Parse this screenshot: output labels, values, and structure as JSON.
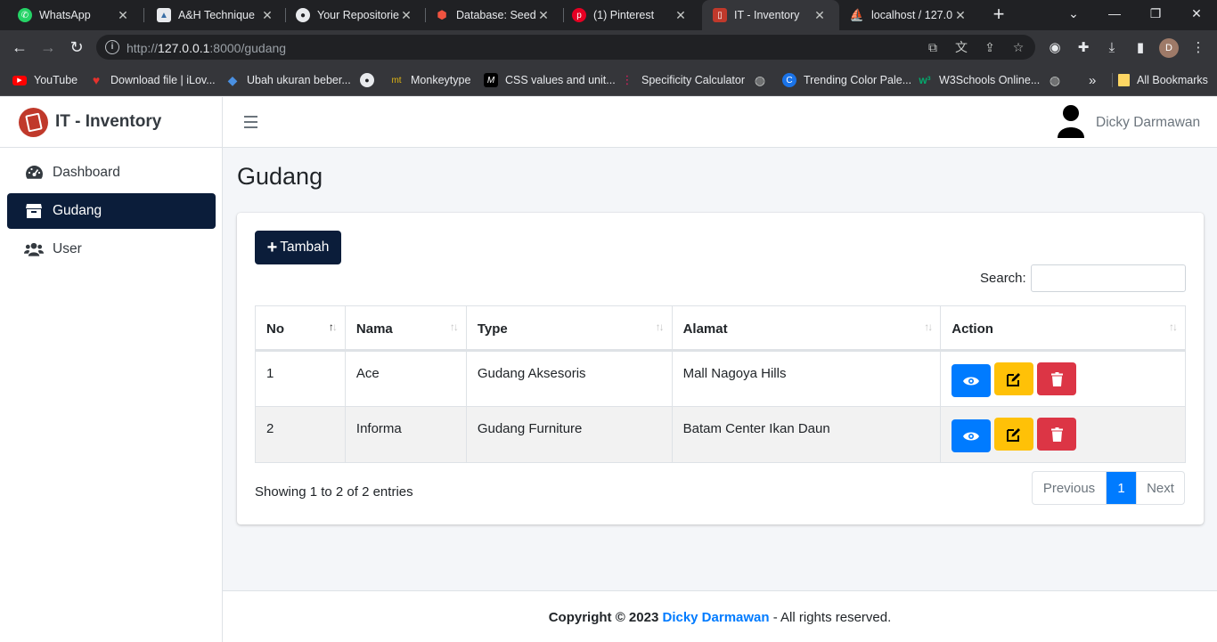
{
  "browser": {
    "tabs": [
      {
        "title": "WhatsApp",
        "icon": "whatsapp-icon"
      },
      {
        "title": "A&H Technique",
        "icon": "ah-icon"
      },
      {
        "title": "Your Repositorie",
        "icon": "github-icon"
      },
      {
        "title": "Database: Seedi",
        "icon": "laravel-icon"
      },
      {
        "title": "(1) Pinterest",
        "icon": "pinterest-icon"
      },
      {
        "title": "IT - Inventory",
        "icon": "book-icon"
      },
      {
        "title": "localhost / 127.0",
        "icon": "phpmyadmin-icon"
      }
    ],
    "url_prefix": "http://",
    "url_host": "127.0.0.1",
    "url_rest": ":8000/gudang",
    "bookmarks": [
      {
        "label": "YouTube"
      },
      {
        "label": "Download file | iLov..."
      },
      {
        "label": "Ubah ukuran beber..."
      },
      {
        "label": ""
      },
      {
        "label": "Monkeytype"
      },
      {
        "label": "CSS values and unit..."
      },
      {
        "label": "Specificity Calculator"
      },
      {
        "label": ""
      },
      {
        "label": "Trending Color Pale..."
      },
      {
        "label": "W3Schools Online..."
      },
      {
        "label": ""
      }
    ],
    "more_bookmarks": "»",
    "all_bookmarks": "All Bookmarks",
    "profile_initial": "D"
  },
  "app": {
    "brand": "IT - Inventory",
    "user_name": "Dicky Darmawan",
    "sidebar": [
      {
        "label": "Dashboard",
        "icon": "dashboard-icon"
      },
      {
        "label": "Gudang",
        "icon": "box-icon"
      },
      {
        "label": "User",
        "icon": "users-icon"
      }
    ],
    "page_title": "Gudang",
    "add_button": "Tambah",
    "search_label": "Search:",
    "search_value": "",
    "table": {
      "headers": [
        "No",
        "Nama",
        "Type",
        "Alamat",
        "Action"
      ],
      "rows": [
        {
          "no": "1",
          "nama": "Ace",
          "type": "Gudang Aksesoris",
          "alamat": "Mall Nagoya Hills"
        },
        {
          "no": "2",
          "nama": "Informa",
          "type": "Gudang Furniture",
          "alamat": "Batam Center Ikan Daun"
        }
      ]
    },
    "info": "Showing 1 to 2 of 2 entries",
    "pagination": {
      "previous": "Previous",
      "current": "1",
      "next": "Next"
    },
    "footer": {
      "copyright": "Copyright © 2023",
      "author": "Dicky Darmawan",
      "suffix": "- All rights reserved."
    }
  },
  "colors": {
    "primary_dark": "#0b1d3a",
    "view": "#007bff",
    "edit": "#ffc107",
    "delete": "#dc3545"
  }
}
